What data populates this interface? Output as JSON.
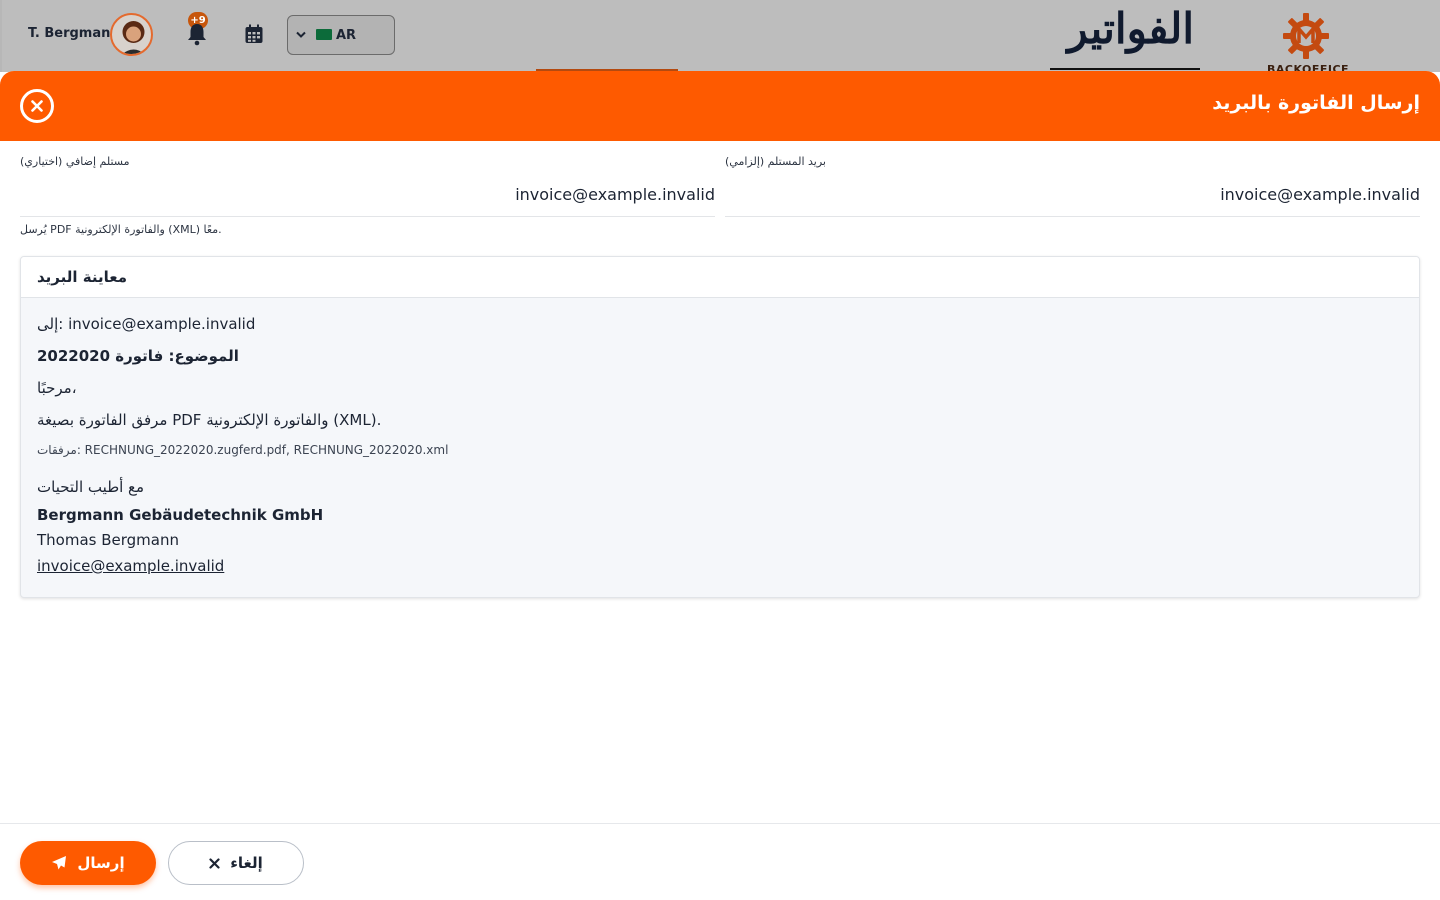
{
  "header": {
    "user_name": "T. Bergmann",
    "notification_count": "+9",
    "language": {
      "selected": "AR",
      "flag": "saudi-arabia-flag"
    },
    "page_title": "الفواتير",
    "logo_text": "BACKOFFICE"
  },
  "modal": {
    "title": "إرسال الفاتورة بالبريد",
    "fields": {
      "primary_label": "بريد المستلم (إلزامي)",
      "primary_value": "invoice@example.invalid",
      "secondary_label": "مستلم إضافي (اختياري)",
      "secondary_value": "invoice@example.invalid",
      "hint": "يُرسل PDF والفاتورة الإلكترونية (XML) معًا."
    },
    "preview": {
      "title": "معاينة البريد",
      "to": "إلى: invoice@example.invalid",
      "subject": "الموضوع: فاتورة 2022020",
      "greeting": "مرحبًا،",
      "body": "مرفق الفاتورة بصيغة PDF والفاتورة الإلكترونية (XML).",
      "attachments": "مرفقات: RECHNUNG_2022020.zugferd.pdf, RECHNUNG_2022020.xml",
      "regards": "مع أطيب التحيات",
      "company": "Bergmann Gebäudetechnik GmbH",
      "person": "Thomas Bergmann",
      "email": "invoice@example.invalid"
    },
    "buttons": {
      "send": "إرسال",
      "cancel": "إلغاء"
    }
  },
  "colors": {
    "accent": "#fe5a00",
    "text": "#1c2433"
  }
}
